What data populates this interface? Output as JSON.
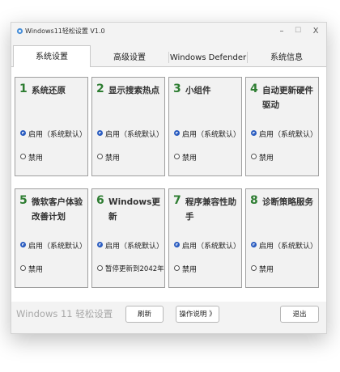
{
  "window": {
    "title": "Windows11轻松设置 V1.0",
    "minimize": "–",
    "maximize": "☐",
    "close": "X"
  },
  "tabs": [
    {
      "label": "系统设置",
      "active": true
    },
    {
      "label": "高级设置",
      "active": false
    },
    {
      "label": "Windows Defender",
      "active": false
    },
    {
      "label": "系统信息",
      "active": false
    }
  ],
  "cards": [
    {
      "num": "1",
      "title": "系统还原",
      "opt1": "启用（系统默认）",
      "opt2": "禁用",
      "selected": 1
    },
    {
      "num": "2",
      "title": "显示搜索热点",
      "opt1": "启用（系统默认）",
      "opt2": "禁用",
      "selected": 1
    },
    {
      "num": "3",
      "title": "小组件",
      "opt1": "启用（系统默认）",
      "opt2": "禁用",
      "selected": 1
    },
    {
      "num": "4",
      "title": "自动更新硬件驱动",
      "opt1": "启用（系统默认）",
      "opt2": "禁用",
      "selected": 1
    },
    {
      "num": "5",
      "title": "微软客户体验改善计划",
      "opt1": "启用（系统默认）",
      "opt2": "禁用",
      "selected": 1
    },
    {
      "num": "6",
      "title": "Windows更新",
      "opt1": "启用（系统默认）",
      "opt2": "暂停更新到2042年",
      "selected": 1
    },
    {
      "num": "7",
      "title": "程序兼容性助手",
      "opt1": "启用（系统默认）",
      "opt2": "禁用",
      "selected": 1
    },
    {
      "num": "8",
      "title": "诊断策略服务",
      "opt1": "启用（系统默认）",
      "opt2": "禁用",
      "selected": 1
    }
  ],
  "footer": {
    "title": "Windows 11 轻松设置",
    "refresh": "刷新",
    "help": "操作说明 》",
    "exit": "退出"
  },
  "colors": {
    "number_green": "#2e7d32",
    "radio_blue": "#2a5cc0"
  },
  "icons": {
    "app": "app-logo-icon"
  }
}
